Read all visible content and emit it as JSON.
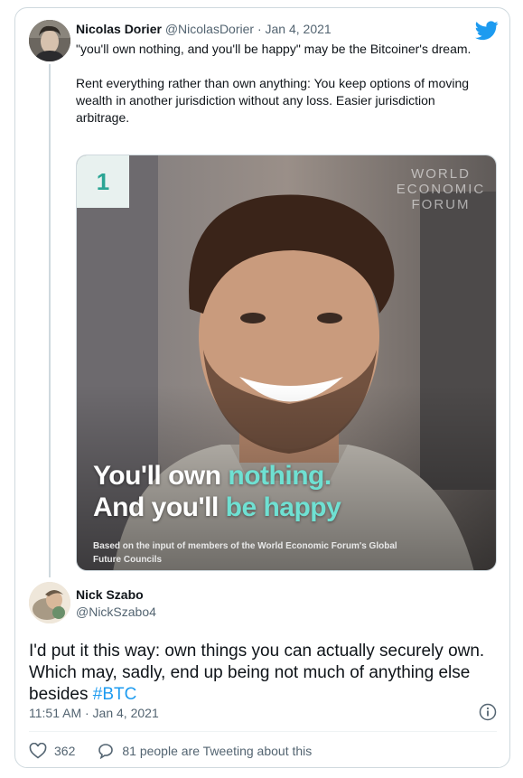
{
  "embed": {
    "brand_color": "#1d9bf0",
    "logo_icon": "twitter-bird-icon"
  },
  "quoted_tweet": {
    "author_name": "Nicolas Dorier",
    "handle": "@NicolasDorier",
    "separator": "·",
    "date": "Jan 4, 2021",
    "text_line1": "\"you'll own nothing, and you'll be happy\" may be the Bitcoiner's dream.",
    "text_line2": "Rent everything rather than own anything: You keep options of moving wealth in another jurisdiction without any loss. Easier jurisdiction arbitrage.",
    "media": {
      "badge": "1",
      "logo_text": [
        "WORLD",
        "ECONOMIC",
        "FORUM"
      ],
      "headline_1a": "You'll own ",
      "headline_1b": "nothing.",
      "headline_2a": "And you'll ",
      "headline_2b": "be happy",
      "caption": "Based on the input of members of the World Economic Forum's Global Future Councils",
      "accent_color": "#6fe0d2"
    }
  },
  "tweet": {
    "author_name": "Nick Szabo",
    "handle": "@NickSzabo4",
    "text_main": "I'd put it this way: own things you can actually securely own. Which may, sadly, end up being not much of anything else besides ",
    "hashtag": "#BTC",
    "timestamp": "11:51 AM · Jan 4, 2021",
    "likes": "362",
    "replies_text": "81 people are Tweeting about this"
  }
}
